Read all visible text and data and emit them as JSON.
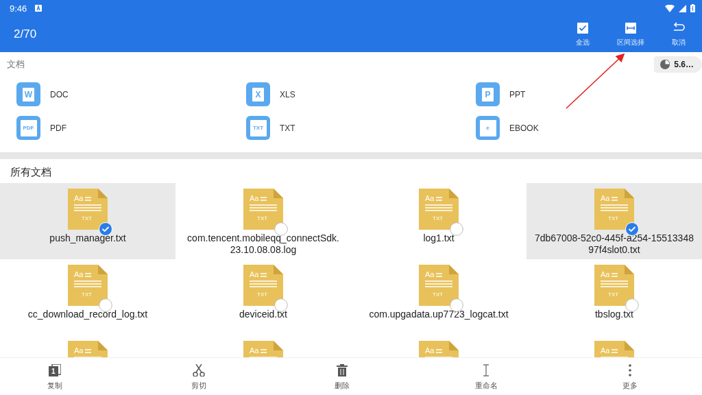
{
  "status_bar": {
    "time": "9:46"
  },
  "toolbar": {
    "count": "2/70",
    "actions": [
      {
        "kind": "select-all",
        "label": "全选"
      },
      {
        "kind": "range",
        "label": "区间选择"
      },
      {
        "kind": "cancel",
        "label": "取消"
      }
    ]
  },
  "documents": {
    "title": "文档",
    "storage": "5.6…",
    "categories": [
      {
        "kind": "doc",
        "letter": "W",
        "label": "DOC"
      },
      {
        "kind": "xls",
        "letter": "X",
        "label": "XLS"
      },
      {
        "kind": "ppt",
        "letter": "P",
        "label": "PPT"
      },
      {
        "kind": "pdf",
        "letter": "PDF",
        "label": "PDF"
      },
      {
        "kind": "txt",
        "letter": "TXT",
        "label": "TXT"
      },
      {
        "kind": "ebook",
        "letter": "e",
        "label": "EBOOK"
      }
    ]
  },
  "all_documents": {
    "title": "所有文档",
    "files": [
      {
        "icon_text": "Aa",
        "icon_label": "TXT",
        "name": "push_manager.txt",
        "selected": true
      },
      {
        "icon_text": "Aa",
        "icon_label": "TXT",
        "name": "com.tencent.mobileqq_connectSdk.\n23.10.08.08.log",
        "selected": false
      },
      {
        "icon_text": "Aa",
        "icon_label": "TXT",
        "name": "log1.txt",
        "selected": false
      },
      {
        "icon_text": "Aa",
        "icon_label": "TXT",
        "name": "7db67008-52c0-445f-a254-15513348\n97f4slot0.txt",
        "selected": true
      },
      {
        "icon_text": "Aa",
        "icon_label": "TXT",
        "name": "cc_download_record_log.txt",
        "selected": false
      },
      {
        "icon_text": "Aa",
        "icon_label": "TXT",
        "name": "deviceid.txt",
        "selected": false
      },
      {
        "icon_text": "Aa",
        "icon_label": "TXT",
        "name": "com.upgadata.up7723_logcat.txt",
        "selected": false
      },
      {
        "icon_text": "Aa",
        "icon_label": "TXT",
        "name": "tbslog.txt",
        "selected": false
      },
      {
        "icon_text": "Aa"
      },
      {
        "icon_text": "Aa"
      },
      {
        "icon_text": "Aa"
      },
      {
        "icon_text": "Aa"
      }
    ]
  },
  "bottom_bar": [
    {
      "kind": "copy",
      "badge": "1",
      "label": "复制"
    },
    {
      "kind": "cut",
      "label": "剪切"
    },
    {
      "kind": "delete",
      "label": "删除"
    },
    {
      "kind": "rename",
      "label": "重命名"
    },
    {
      "kind": "more",
      "label": "更多"
    }
  ]
}
